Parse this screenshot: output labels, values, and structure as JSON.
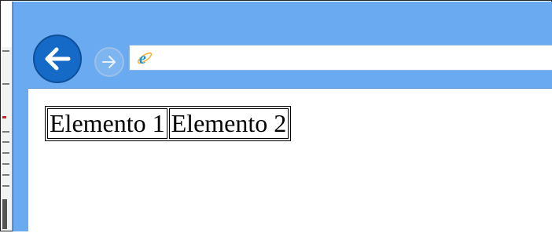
{
  "colors": {
    "window_frame": "#6aaaf0",
    "back_button": "#1569c7",
    "forward_button": "#7db5f1",
    "ie_logo": "#1c8fe0"
  },
  "toolbar": {
    "back_icon": "arrow-left-icon",
    "forward_icon": "arrow-right-icon",
    "page_icon": "internet-explorer-icon",
    "address_value": ""
  },
  "table": {
    "cells": [
      "Elemento 1",
      "Elemento 2"
    ]
  }
}
